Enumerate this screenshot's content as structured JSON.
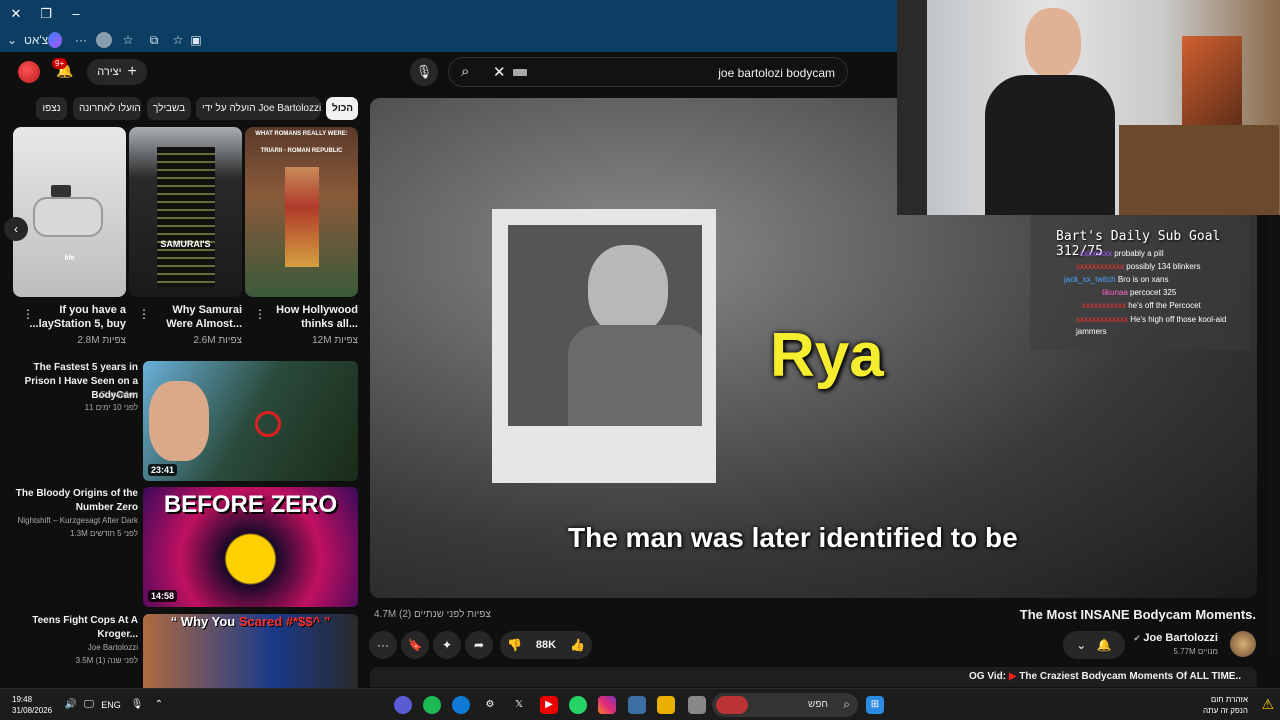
{
  "browser": {
    "profile_label": "צ'אט",
    "window_controls": {
      "close": "✕",
      "restore": "❐",
      "minimize": "–"
    }
  },
  "youtube": {
    "notifications_badge": "9+",
    "create_label": "יצירה",
    "search_query": "joe bartolozi bodycam",
    "chips": [
      "הכול",
      "הועלה על ידי Joe Bartolozzi",
      "בשבילך",
      "הועלו לאחרונה",
      "נצפו"
    ],
    "shorts": [
      {
        "title_line1": "How Hollywood",
        "title_line2": "thinks all...",
        "views": "12M צפיות",
        "caption": "TRIARII - ROMAN REPUBLIC",
        "top_text": "WHAT ROMANS REALLY WERE:"
      },
      {
        "title_line1": "Why Samurai",
        "title_line2": "Were Almost...",
        "views": "2.6M צפיות",
        "caption": "SAMURAI'S"
      },
      {
        "title_line1": "If you have a",
        "title_line2": "...layStation 5, buy",
        "views": "2.8M צפיות",
        "caption": "life"
      }
    ],
    "recommendations": [
      {
        "title": "The Fastest 5 years in Prison I Have Seen on a BodyCam",
        "channel": "Starwalker",
        "meta": "11 לפני 10 ימים",
        "duration": "23:41"
      },
      {
        "title": "The Bloody Origins of the Number Zero",
        "channel": "Nightshift – Kurzgesagt After Dark",
        "meta": "1.3M לפני 5 חודשים",
        "duration": "14:58",
        "thumb_text": "BEFORE ZERO"
      },
      {
        "title": "Teens Fight Cops At A Kroger...",
        "channel": "Joe Bartolozzi",
        "meta": "3.5M לפני שנה (1)",
        "duration": "",
        "thumb_text_a": "“ Why You",
        "thumb_text_b": "Scared #*$$^ ”"
      }
    ],
    "player": {
      "overlay_name": "Rya",
      "subtitle": "The man was later identified to be"
    },
    "video": {
      "title": "The Most INSANE Bodycam Moments.",
      "views": "4.7M צפיות  לפני שנתיים (2)",
      "channel": "Joe Bartolozzi",
      "subs": "5.77M מנויים",
      "likes": "88K"
    },
    "og_vid": {
      "label": "OG Vid:",
      "text": "The Craziest Bodycam Moments Of ALL TIME.."
    }
  },
  "stream_overlay": {
    "sub_goal": "Bart's Daily Sub Goal 312/75",
    "chat": [
      {
        "user": "xxxxxxxx",
        "msg": "probably a pill",
        "color": "#9b59ff"
      },
      {
        "user": "xxxxxxxxxxxx",
        "msg": "possibly 134 blinkers",
        "color": "#ff3030"
      },
      {
        "user": "jack_xx_twitch",
        "msg": "Bro is on xans",
        "color": "#4fa3ff"
      },
      {
        "user": "tikunaa",
        "msg": "percocet 325",
        "color": "#ff66cc"
      },
      {
        "user": "xxxxxxxxxxx",
        "msg": "he's off the Percocet",
        "color": "#ff3030"
      },
      {
        "user": "xxxxxxxxxxxxx",
        "msg": "He's high off those kool-aid jammers",
        "color": "#ff3030"
      }
    ]
  },
  "taskbar": {
    "time": "19:48",
    "date": "31/08/2026",
    "lang": "ENG",
    "search_placeholder": "חפש",
    "weather_line1": "אזהרת חום",
    "weather_line2": "הנפק זה עתה"
  }
}
